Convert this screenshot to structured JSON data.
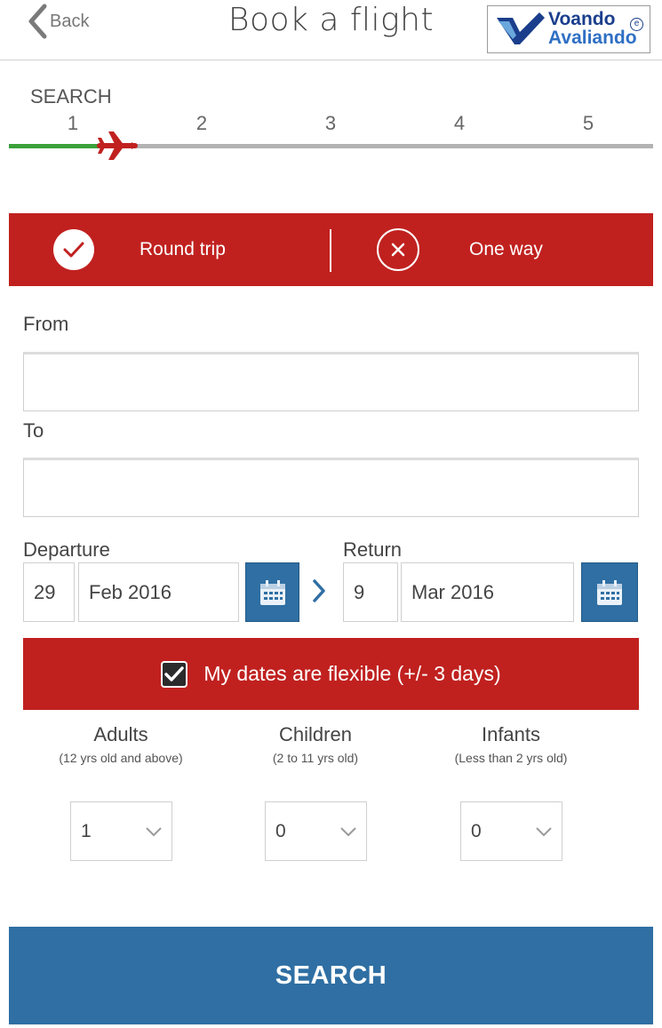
{
  "header": {
    "back_label": "Back",
    "title": "Book a flight",
    "logo": {
      "line1": "Voando",
      "line2": "Avaliando",
      "mark": "e"
    }
  },
  "steps": {
    "current_label": "SEARCH",
    "numbers": [
      "1",
      "2",
      "3",
      "4",
      "5"
    ],
    "current_index": 1
  },
  "trip_type": {
    "round_trip_label": "Round trip",
    "one_way_label": "One way",
    "selected": "round_trip"
  },
  "form": {
    "from_label": "From",
    "from_value": "",
    "to_label": "To",
    "to_value": "",
    "departure_label": "Departure",
    "departure_day": "29",
    "departure_month": "Feb 2016",
    "return_label": "Return",
    "return_day": "9",
    "return_month": "Mar 2016"
  },
  "flexible": {
    "label": "My dates are flexible (+/- 3 days)",
    "checked": true
  },
  "passengers": {
    "adults": {
      "title": "Adults",
      "subtitle": "(12 yrs old and above)",
      "value": "1"
    },
    "children": {
      "title": "Children",
      "subtitle": "(2 to 11 yrs old)",
      "value": "0"
    },
    "infants": {
      "title": "Infants",
      "subtitle": "(Less than 2 yrs old)",
      "value": "0"
    }
  },
  "search_button_label": "SEARCH",
  "colors": {
    "brand_red": "#c0211f",
    "brand_blue": "#2f6fa3",
    "progress_green": "#3aa13a",
    "logo_blue": "#1a3e8c"
  },
  "icons": {
    "back": "chevron-left-icon",
    "plane": "plane-icon",
    "round_trip": "check-circle-icon",
    "one_way": "x-circle-icon",
    "calendar": "calendar-icon",
    "date_arrow": "chevron-right-icon",
    "checkbox": "checkmark-icon",
    "select": "chevron-down-icon"
  }
}
